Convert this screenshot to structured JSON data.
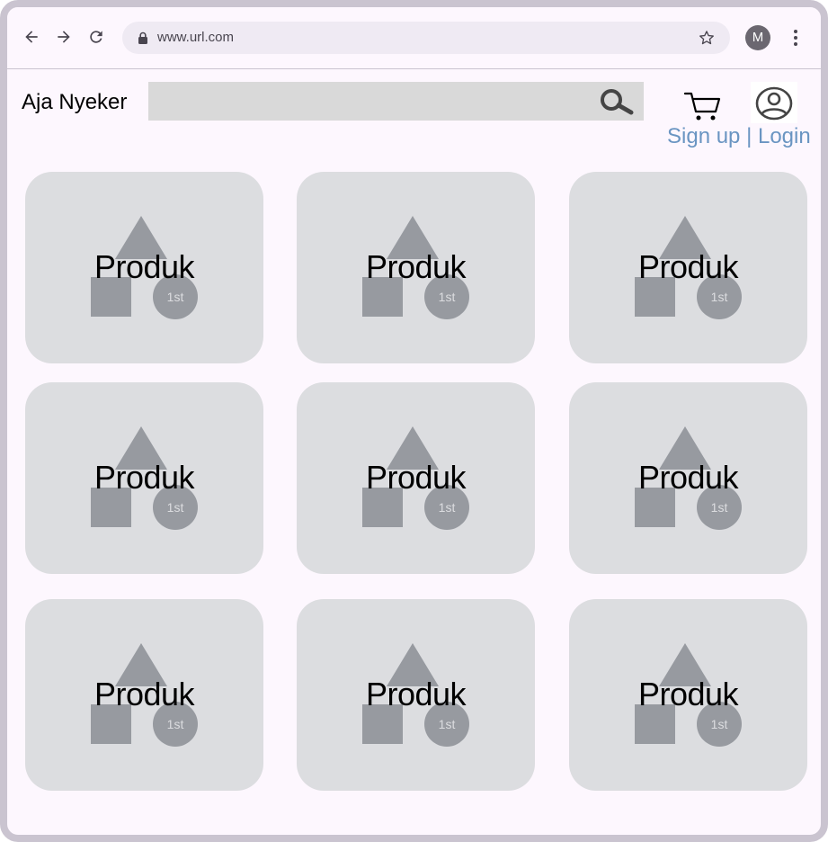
{
  "browser": {
    "url": "www.url.com",
    "profile_initial": "M"
  },
  "site": {
    "brand": "Aja Nyeker",
    "search": {
      "value": ""
    },
    "auth": {
      "signup": "Sign up",
      "separator": " | ",
      "login": "Login"
    }
  },
  "products": [
    {
      "title": "Produk",
      "badge": "1st"
    },
    {
      "title": "Produk",
      "badge": "1st"
    },
    {
      "title": "Produk",
      "badge": "1st"
    },
    {
      "title": "Produk",
      "badge": "1st"
    },
    {
      "title": "Produk",
      "badge": "1st"
    },
    {
      "title": "Produk",
      "badge": "1st"
    },
    {
      "title": "Produk",
      "badge": "1st"
    },
    {
      "title": "Produk",
      "badge": "1st"
    },
    {
      "title": "Produk",
      "badge": "1st"
    }
  ],
  "colors": {
    "frame": "#cac4d0",
    "page_bg": "#fdf7fe",
    "card_bg": "#dcdde0",
    "placeholder_shape": "#979aa0",
    "link": "#6a95c2"
  },
  "icons": [
    "back-arrow-icon",
    "forward-arrow-icon",
    "reload-icon",
    "lock-icon",
    "star-icon",
    "more-vert-icon",
    "search-icon",
    "cart-icon",
    "user-icon"
  ]
}
